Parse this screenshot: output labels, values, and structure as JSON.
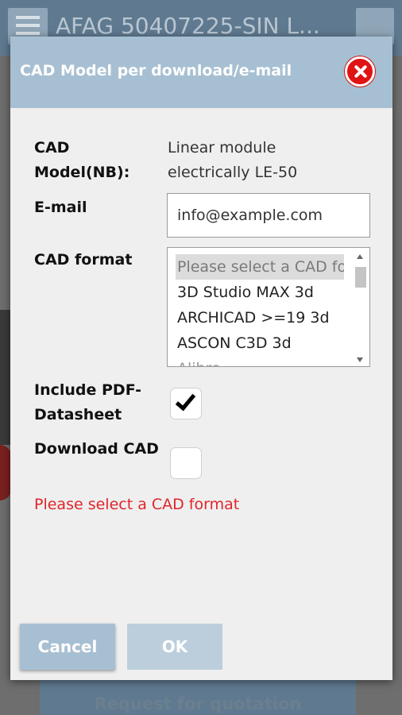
{
  "background": {
    "title": "AFAG 50407225-SIN L...",
    "quote_button": "Request for quotation"
  },
  "dialog": {
    "title": "CAD Model per download/e-mail",
    "cad_model_label": "CAD Model(NB):",
    "cad_model_value": "Linear module electrically LE-50",
    "email_label": "E-mail",
    "email_value": "info@example.com",
    "cad_format_label": "CAD format",
    "cad_format_options": [
      "Please select a CAD format",
      "3D Studio MAX 3d",
      "ARCHICAD >=19 3d",
      "ASCON C3D 3d",
      "Alibre ...",
      ""
    ],
    "include_pdf_label": "Include PDF-Datasheet",
    "include_pdf_checked": true,
    "download_cad_label": "Download CAD",
    "download_cad_checked": false,
    "error_message": "Please select a CAD format",
    "cancel_label": "Cancel",
    "ok_label": "OK"
  },
  "colors": {
    "header": "#a7bfd2",
    "error": "#e0252b",
    "close": "#e01414"
  }
}
